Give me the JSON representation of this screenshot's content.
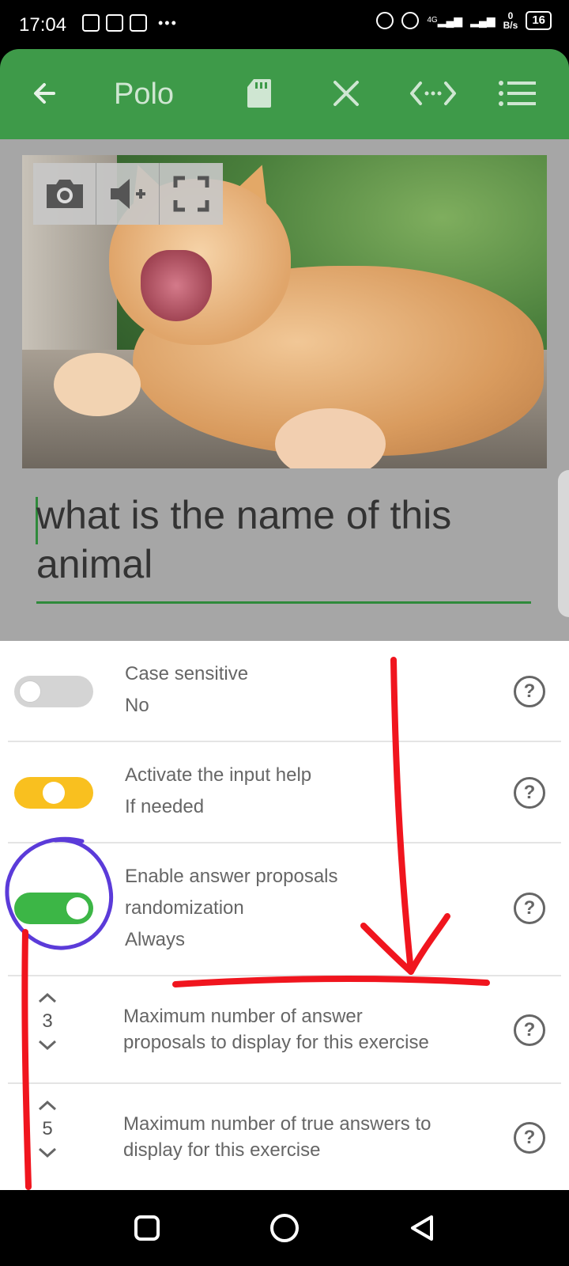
{
  "status_bar": {
    "time": "17:04",
    "network_type": "4G",
    "data_rate_value": "0",
    "data_rate_unit": "B/s",
    "battery": "16"
  },
  "app_bar": {
    "title": "Polo",
    "icons": [
      "back-arrow-icon",
      "sd-card-icon",
      "close-icon",
      "code-arrows-icon",
      "menu-list-icon"
    ],
    "background_color": "#3e9a49"
  },
  "question": {
    "text": "what is the name of this animal"
  },
  "media_toolbar": {
    "icons": [
      "camera-icon",
      "volume-up-icon",
      "fullscreen-icon"
    ]
  },
  "settings": {
    "case_sensitive": {
      "title": "Case sensitive",
      "value": "No",
      "toggle": "off"
    },
    "input_help": {
      "title": "Activate the input help",
      "value": "If needed",
      "toggle": "partial",
      "color": "#f9c01f"
    },
    "randomization": {
      "title_line1": "Enable answer proposals",
      "title_line2": "randomization",
      "value": "Always",
      "toggle": "on",
      "color": "#3cb646"
    },
    "max_proposals": {
      "count": "3",
      "line1": "Maximum number of answer",
      "line2": "proposals to display for this exercise"
    },
    "max_true_answers": {
      "count": "5",
      "line1": "Maximum number of true answers to",
      "line2": "display for this exercise"
    },
    "help_symbol": "?"
  },
  "nav_bar": {
    "icons": [
      "recents-square-icon",
      "home-circle-icon",
      "back-triangle-icon"
    ]
  }
}
